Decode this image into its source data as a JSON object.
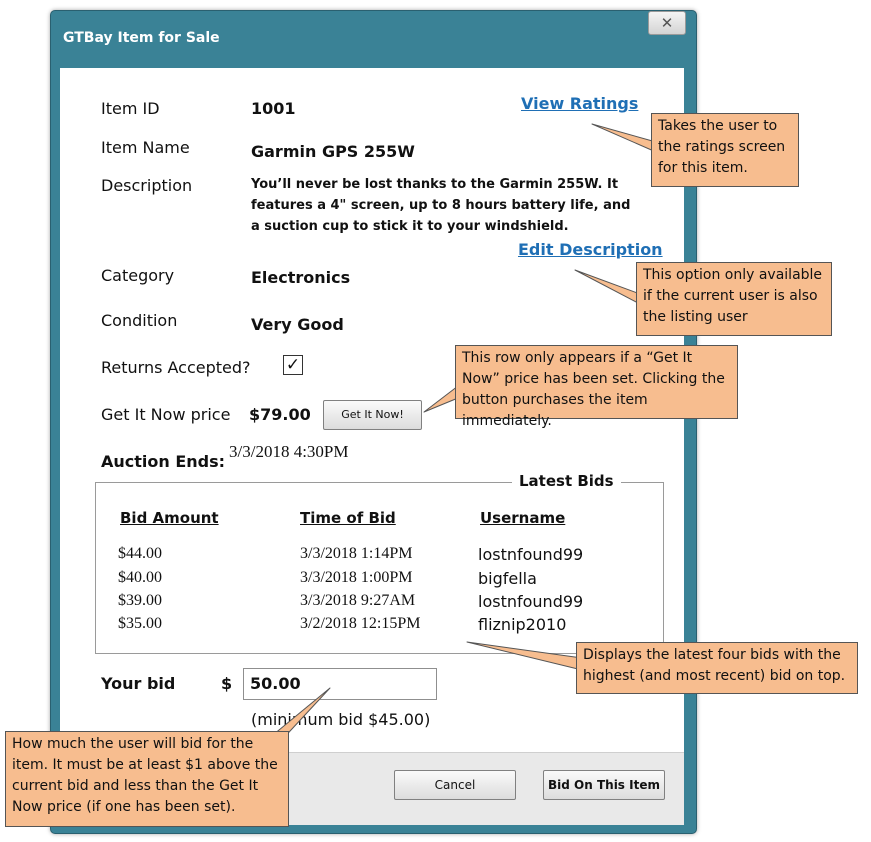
{
  "window": {
    "title": "GTBay Item for Sale",
    "close_glyph": "✕"
  },
  "item": {
    "id_label": "Item ID",
    "id_value": "1001",
    "name_label": "Item Name",
    "name_value": "Garmin GPS 255W",
    "description_label": "Description",
    "description_value": "You’ll never be lost thanks to the Garmin 255W.  It features a 4\" screen, up to 8 hours battery life, and a suction cup to stick it to your windshield.",
    "category_label": "Category",
    "category_value": "Electronics",
    "condition_label": "Condition",
    "condition_value": "Very Good",
    "returns_label": "Returns Accepted?",
    "returns_checked": true,
    "returns_check_glyph": "✓",
    "get_it_now_label": "Get It Now price",
    "get_it_now_value": "$79.00",
    "get_it_now_button": "Get It Now!",
    "auction_ends_label": "Auction Ends:",
    "auction_ends_value": "3/3/2018 4:30PM"
  },
  "links": {
    "view_ratings": "View Ratings",
    "edit_description": "Edit Description"
  },
  "latest_bids": {
    "title": "Latest Bids",
    "columns": [
      "Bid Amount",
      "Time of Bid",
      "Username"
    ],
    "rows": [
      [
        "$44.00",
        "3/3/2018 1:14PM",
        "lostnfound99"
      ],
      [
        "$40.00",
        "3/3/2018 1:00PM",
        "bigfella"
      ],
      [
        "$39.00",
        "3/3/2018 9:27AM",
        "lostnfound99"
      ],
      [
        "$35.00",
        "3/2/2018 12:15PM",
        "fliznip2010"
      ]
    ]
  },
  "your_bid": {
    "label": "Your bid",
    "currency": "$",
    "value": "50.00",
    "hint": "(minimum bid $45.00)"
  },
  "buttons": {
    "cancel": "Cancel",
    "bid": "Bid On This Item"
  },
  "callouts": {
    "view_ratings": "Takes the user to the ratings screen for this item.",
    "edit_description": "This option only available if the current user is also the listing user",
    "get_it_now": "This row only appears if a “Get It Now” price has been set.  Clicking the button purchases the item immediately.",
    "latest_bids": "Displays the latest four bids with the highest (and most recent) bid on top.",
    "your_bid": "How much the user will bid for the item.  It must be at least $1 above the current bid and less than the Get It Now price (if one has been set)."
  },
  "colors": {
    "titlebar": "#3a8296",
    "link": "#1f6fb5",
    "callout": "#f7bd8f"
  }
}
